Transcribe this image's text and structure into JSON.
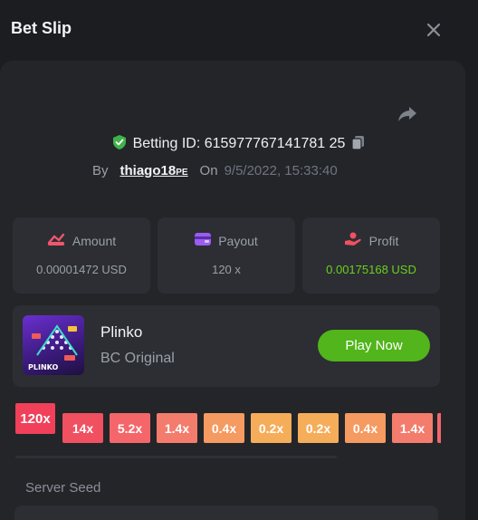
{
  "dialog": {
    "title": "Bet Slip"
  },
  "bet": {
    "id_label": "Betting ID: 615977767141781 25",
    "by_label": "By",
    "username": "thiago18",
    "username_suffix": "PE",
    "on_label": "On",
    "datetime": "9/5/2022, 15:33:40"
  },
  "stats": {
    "amount": {
      "label": "Amount",
      "value": "0.00001472 USD"
    },
    "payout": {
      "label": "Payout",
      "value": "120 x"
    },
    "profit": {
      "label": "Profit",
      "value": "0.00175168 USD"
    }
  },
  "game": {
    "name": "Plinko",
    "provider": "BC Original",
    "play_label": "Play Now",
    "thumb_text": "PLINKO"
  },
  "multipliers": [
    {
      "label": "120x",
      "color": "#f0405a",
      "active": true
    },
    {
      "label": "14x",
      "color": "#f05060",
      "active": false
    },
    {
      "label": "5.2x",
      "color": "#f4666a",
      "active": false
    },
    {
      "label": "1.4x",
      "color": "#f47c6c",
      "active": false
    },
    {
      "label": "0.4x",
      "color": "#f59a60",
      "active": false
    },
    {
      "label": "0.2x",
      "color": "#f5ad5a",
      "active": false
    },
    {
      "label": "0.2x",
      "color": "#f5ad5a",
      "active": false
    },
    {
      "label": "0.4x",
      "color": "#f59a60",
      "active": false
    },
    {
      "label": "1.4x",
      "color": "#f47c6c",
      "active": false
    },
    {
      "label": "",
      "color": "#f4666a",
      "active": false
    }
  ],
  "seed": {
    "label": "Server Seed"
  },
  "colors": {
    "accent_green": "#51b51b",
    "profit_green": "#6ccf1f",
    "panel": "#232529",
    "card": "#2c2e33"
  }
}
